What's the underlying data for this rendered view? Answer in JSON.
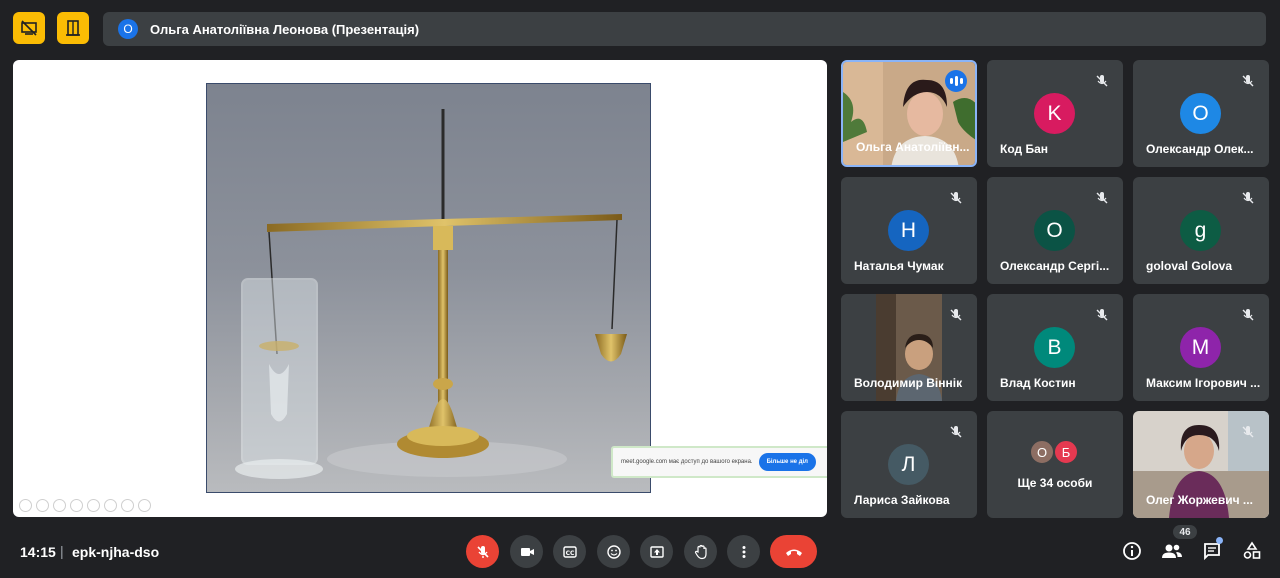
{
  "header": {
    "presenter_initial": "О",
    "presenter_title": "Ольга Анатоліївна Леонова (Презентація)"
  },
  "notice": {
    "text": "meet.google.com має доступ до вашого екрана.",
    "button": "Більше не діл"
  },
  "participants": [
    {
      "name": "Ольга Анатоліївн...",
      "type": "video",
      "active": true
    },
    {
      "name": "Код Бан",
      "initial": "K",
      "color": "#d81b60"
    },
    {
      "name": "Олександр Олек...",
      "initial": "О",
      "color": "#1e88e5"
    },
    {
      "name": "Наталья Чумак",
      "initial": "Н",
      "color": "#1565c0"
    },
    {
      "name": "Олександр Сергі...",
      "initial": "О",
      "color": "#0b5345"
    },
    {
      "name": "goloval Golova",
      "initial": "g",
      "color": "#0d5c44"
    },
    {
      "name": "Володимир Віннік",
      "type": "video"
    },
    {
      "name": "Влад Костин",
      "initial": "В",
      "color": "#00897b"
    },
    {
      "name": "Максим Ігорович ...",
      "initial": "М",
      "color": "#8e24aa"
    },
    {
      "name": "Лариса Зайкова",
      "initial": "Л",
      "color": "#455a64"
    },
    {
      "name": "Олег Жоржевич ...",
      "type": "video"
    }
  ],
  "more": {
    "label": "Ще 34 особи",
    "initials": [
      "О",
      "Б"
    ],
    "colors": [
      "#8d6e63",
      "#e53950"
    ]
  },
  "bottom": {
    "time": "14:15",
    "separator": "|",
    "meeting_code": "epk-njha-dso",
    "people_count": "46"
  }
}
